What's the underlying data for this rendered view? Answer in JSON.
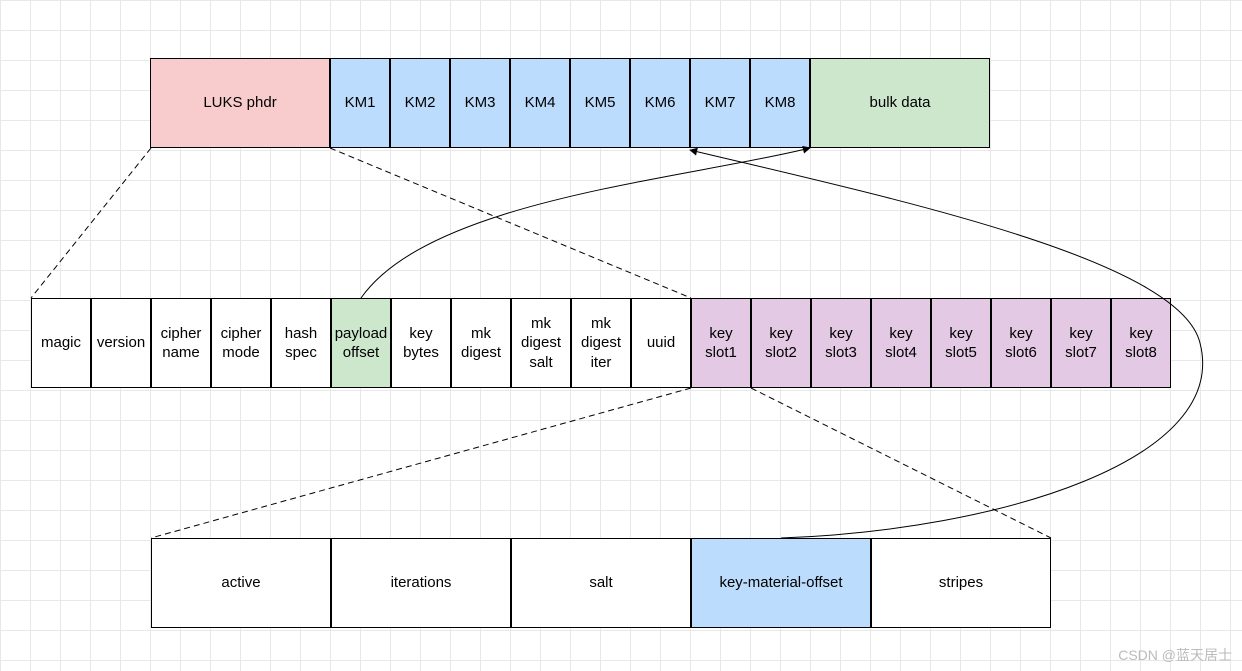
{
  "row1": {
    "luks_phdr": "LUKS phdr",
    "km": [
      "KM1",
      "KM2",
      "KM3",
      "KM4",
      "KM5",
      "KM6",
      "KM7",
      "KM8"
    ],
    "bulk": "bulk data"
  },
  "row2": {
    "fields": {
      "magic": "magic",
      "version": "version",
      "cipher_name": "cipher name",
      "cipher_mode": "cipher mode",
      "hash_spec": "hash spec",
      "payload_offset": "payload offset",
      "key_bytes": "key bytes",
      "mk_digest": "mk digest",
      "mk_digest_salt": "mk digest salt",
      "mk_digest_iter": "mk digest iter",
      "uuid": "uuid"
    },
    "keyslots": [
      "key slot1",
      "key slot2",
      "key slot3",
      "key slot4",
      "key slot5",
      "key slot6",
      "key slot7",
      "key slot8"
    ]
  },
  "row3": {
    "active": "active",
    "iterations": "iterations",
    "salt": "salt",
    "key_material_offset": "key-material-offset",
    "stripes": "stripes"
  },
  "watermark": "CSDN @蓝天居士"
}
